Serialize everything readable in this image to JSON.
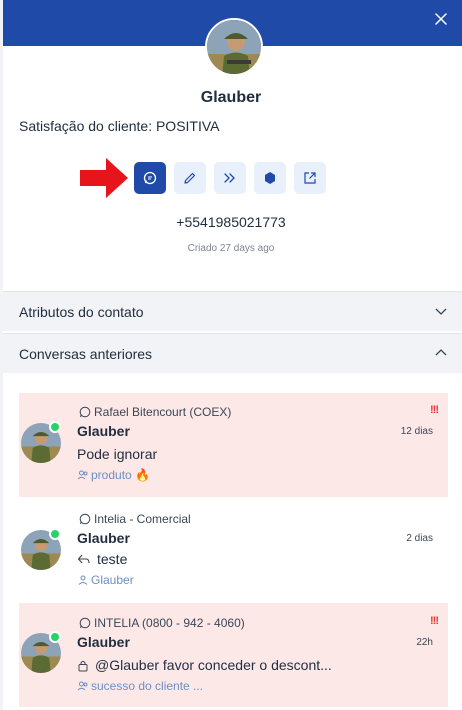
{
  "header": {
    "close_icon": "close-icon",
    "accent": "#1f4aa8"
  },
  "contact": {
    "name": "Glauber",
    "satisfaction": "Satisfação do cliente: POSITIVA",
    "phone": "+5541985021773",
    "created": "Criado 27 days ago"
  },
  "actions": [
    {
      "icon": "chat-icon",
      "active": true
    },
    {
      "icon": "edit-icon"
    },
    {
      "icon": "merge-icon"
    },
    {
      "icon": "hexagon-icon"
    },
    {
      "icon": "external-link-icon"
    }
  ],
  "accordions": {
    "attributes": "Atributos do contato",
    "previous": "Conversas anteriores"
  },
  "conversations": [
    {
      "inbox": "Rafael Bitencourt (COEX)",
      "name": "Glauber",
      "time": "12 dias",
      "message": "Pode ignorar",
      "label": "produto 🔥",
      "priority": "!!!",
      "highlight": true
    },
    {
      "inbox": "Intelia - Comercial",
      "name": "Glauber",
      "time": "2 dias",
      "message": "teste",
      "label": "Glauber",
      "highlight": false
    },
    {
      "inbox": "INTELIA (0800 - 942 - 4060)",
      "name": "Glauber",
      "time": "22h",
      "message": "@Glauber favor conceder o descont...",
      "label": "sucesso do cliente ...",
      "priority": "!!!",
      "highlight": true
    }
  ],
  "colors": {
    "priority": "#e53935",
    "pink_row": "#fde8e8",
    "label_blue": "#6b8fc2",
    "arrow_red": "#e8141c"
  }
}
